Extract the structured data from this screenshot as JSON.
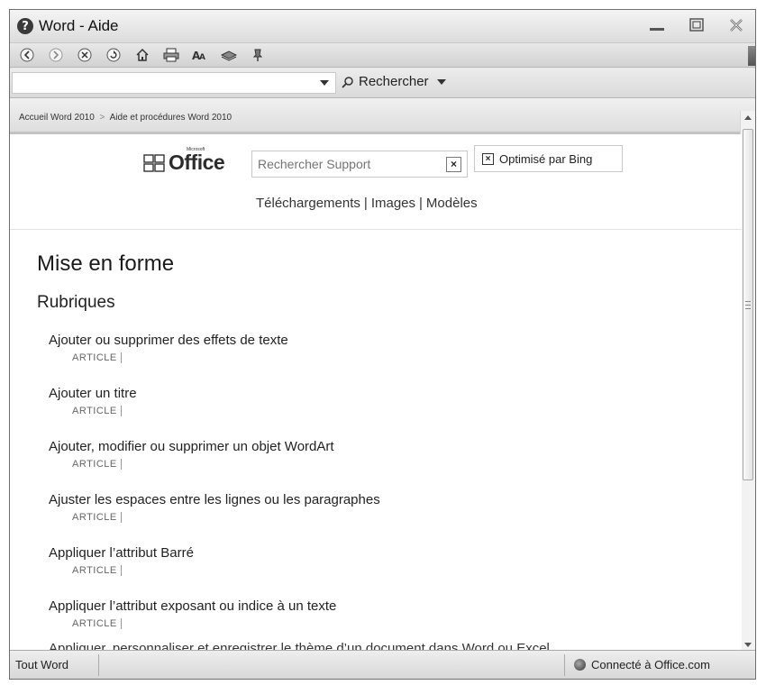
{
  "window": {
    "title": "Word - Aide"
  },
  "toolbar": {
    "buttons": [
      "back-icon",
      "forward-icon",
      "stop-icon",
      "refresh-icon",
      "home-icon",
      "print-icon",
      "font-size-icon",
      "book-icon",
      "pin-icon"
    ]
  },
  "search": {
    "value": "",
    "button_label": "Rechercher"
  },
  "breadcrumb": {
    "items": [
      "Accueil Word 2010",
      "Aide et procédures Word 2010"
    ],
    "separator": ">"
  },
  "office": {
    "logo_text": "Office",
    "logo_small": "Microsoft",
    "support_placeholder": "Rechercher Support",
    "bing_label": "Optimisé par Bing",
    "links": [
      "Téléchargements",
      "Images",
      "Modèles"
    ],
    "link_separator": "|"
  },
  "page": {
    "title": "Mise en forme",
    "section": "Rubriques",
    "topics": [
      {
        "title": "Ajouter ou supprimer des effets de texte",
        "type": "ARTICLE"
      },
      {
        "title": "Ajouter un titre",
        "type": "ARTICLE"
      },
      {
        "title": "Ajouter, modifier ou supprimer un objet WordArt",
        "type": "ARTICLE"
      },
      {
        "title": "Ajuster les espaces entre les lignes ou les paragraphes",
        "type": "ARTICLE"
      },
      {
        "title": "Appliquer l’attribut Barré",
        "type": "ARTICLE"
      },
      {
        "title": "Appliquer l’attribut exposant ou indice à un texte",
        "type": "ARTICLE"
      }
    ],
    "cut_topic": "Appliquer, personnaliser et enregistrer le thème d’un document dans Word ou Excel"
  },
  "status": {
    "scope": "Tout Word",
    "connection": "Connecté à Office.com"
  }
}
